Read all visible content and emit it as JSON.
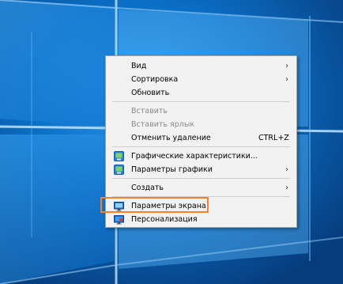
{
  "desktop": {
    "background_color": "#0a5fae",
    "logo": "windows-10-logo"
  },
  "context_menu": {
    "items": [
      {
        "label": "Вид",
        "has_submenu": true,
        "enabled": true
      },
      {
        "label": "Сортировка",
        "has_submenu": true,
        "enabled": true
      },
      {
        "label": "Обновить",
        "enabled": true
      },
      {
        "label": "Вставить",
        "enabled": false
      },
      {
        "label": "Вставить ярлык",
        "enabled": false
      },
      {
        "label": "Отменить удаление",
        "shortcut": "CTRL+Z",
        "enabled": true
      },
      {
        "label": "Графические характеристики...",
        "icon": "intel-graphics-icon",
        "enabled": true
      },
      {
        "label": "Параметры графики",
        "icon": "intel-graphics-icon",
        "has_submenu": true,
        "enabled": true
      },
      {
        "label": "Создать",
        "has_submenu": true,
        "enabled": true
      },
      {
        "label": "Параметры экрана",
        "icon": "display-icon",
        "enabled": true,
        "highlighted": true
      },
      {
        "label": "Персонализация",
        "icon": "personalization-icon",
        "enabled": true
      }
    ],
    "submenu_arrow": "›",
    "highlight_color": "#ff7f27"
  }
}
